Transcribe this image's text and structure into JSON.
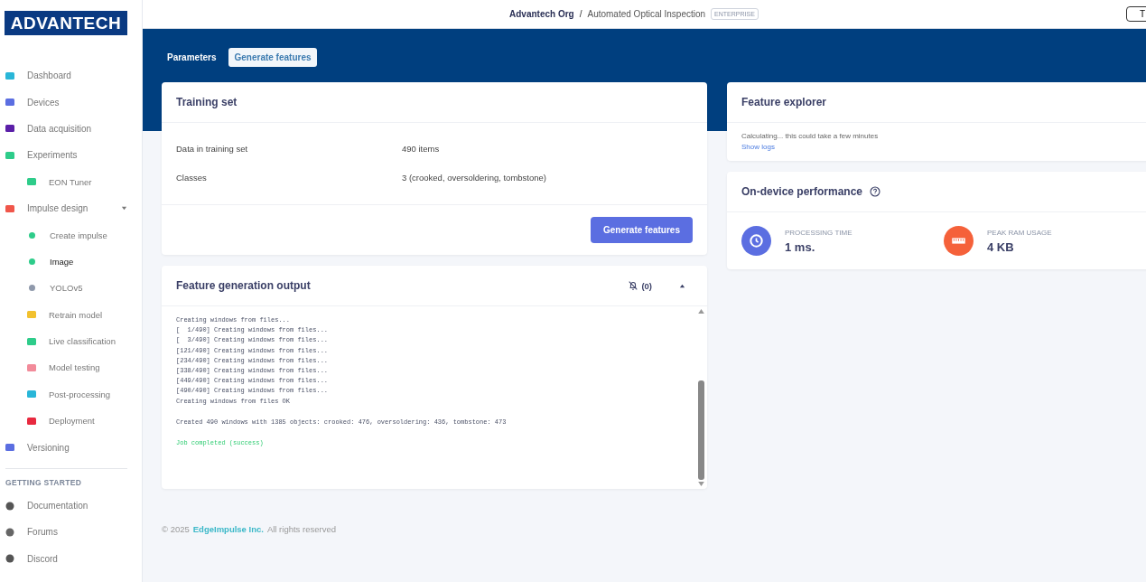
{
  "logo": "ADVANTECH",
  "sidebar": {
    "items": [
      {
        "label": "Dashboard",
        "kind": "item",
        "selected": false
      },
      {
        "label": "Devices",
        "kind": "item",
        "selected": false
      },
      {
        "label": "Data acquisition",
        "kind": "item",
        "selected": false
      },
      {
        "label": "Experiments",
        "kind": "item",
        "selected": false
      },
      {
        "label": "EON Tuner",
        "kind": "subitem",
        "selected": false
      },
      {
        "label": "Impulse design",
        "kind": "item",
        "selected": false,
        "expanded": true
      },
      {
        "label": "Create impulse",
        "kind": "dot",
        "color": "#2ecc8a",
        "selected": false
      },
      {
        "label": "Image",
        "kind": "dot",
        "color": "#2ecc8a",
        "selected": true
      },
      {
        "label": "YOLOv5",
        "kind": "dot",
        "color": "#8f99ab",
        "selected": false
      },
      {
        "label": "Retrain model",
        "kind": "subitem",
        "selected": false
      },
      {
        "label": "Live classification",
        "kind": "subitem",
        "selected": false
      },
      {
        "label": "Model testing",
        "kind": "subitem",
        "selected": false
      },
      {
        "label": "Post-processing",
        "kind": "subitem",
        "selected": false
      },
      {
        "label": "Deployment",
        "kind": "subitem",
        "selected": false
      },
      {
        "label": "Versioning",
        "kind": "item",
        "selected": false
      }
    ],
    "section": "GETTING STARTED",
    "links": [
      "Documentation",
      "Forums",
      "Discord"
    ]
  },
  "breadcrumb": {
    "org": "Advantech Org",
    "separator": "/",
    "project": "Automated Optical Inspection",
    "badge": "ENTERPRISE",
    "button": "T"
  },
  "tabs": [
    {
      "label": "Parameters",
      "selected": false
    },
    {
      "label": "Generate features",
      "selected": true
    }
  ],
  "training_set": {
    "title": "Training set",
    "rows": [
      {
        "label": "Data in training set",
        "value": "490 items"
      },
      {
        "label": "Classes",
        "value": "3 (crooked, oversoldering, tombstone)"
      }
    ],
    "button": "Generate features"
  },
  "output": {
    "title": "Feature generation output",
    "count": "(0)",
    "expanded": true,
    "log": [
      {
        "kind": "info",
        "lines": [
          "Creating windows from files...",
          "[  1/490] Creating windows from files...",
          "[  3/490] Creating windows from files...",
          "[121/490] Creating windows from files...",
          "[234/490] Creating windows from files...",
          "[338/490] Creating windows from files...",
          "[449/490] Creating windows from files...",
          "[490/490] Creating windows from files...",
          "Creating windows from files OK"
        ]
      },
      {
        "kind": "info",
        "lines": [
          "Created 490 windows with 1385 objects: crooked: 476, oversoldering: 436, tombstone: 473"
        ]
      },
      {
        "kind": "success",
        "lines": [
          "Job completed (success)"
        ]
      }
    ]
  },
  "feature_explorer": {
    "title": "Feature explorer",
    "message": "Calculating... this could take a few minutes",
    "link": "Show logs"
  },
  "performance": {
    "title": "On-device performance",
    "metrics": [
      {
        "kind": "time",
        "label": "PROCESSING TIME",
        "value": "1 ms."
      },
      {
        "kind": "ram",
        "label": "PEAK RAM USAGE",
        "value": "4 KB"
      }
    ]
  },
  "footer": {
    "prefix": "© 2025",
    "company": "EdgeImpulse Inc.",
    "suffix": "All rights reserved"
  }
}
